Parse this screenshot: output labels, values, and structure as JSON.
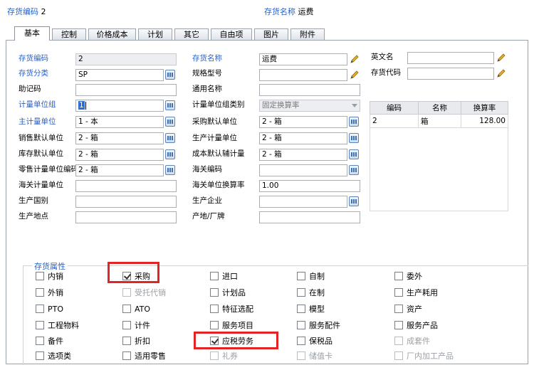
{
  "header": {
    "code_label": "存货编码",
    "code_value": "2",
    "name_label": "存货名称",
    "name_value": "运费"
  },
  "tabs": [
    "基本",
    "控制",
    "价格成本",
    "计划",
    "其它",
    "自由项",
    "图片",
    "附件"
  ],
  "fields": {
    "code": {
      "label": "存货编码",
      "value": "2"
    },
    "category": {
      "label": "存货分类",
      "value": "SP"
    },
    "mnemonic": {
      "label": "助记码",
      "value": ""
    },
    "unit_group": {
      "label": "计量单位组",
      "value": "1"
    },
    "main_unit": {
      "label": "主计量单位",
      "value": "1 - 本"
    },
    "sales_unit": {
      "label": "销售默认单位",
      "value": "2 - 箱"
    },
    "stock_unit": {
      "label": "库存默认单位",
      "value": "2 - 箱"
    },
    "retail_unit": {
      "label": "零售计量单位编码",
      "value": "2 - 箱"
    },
    "customs_unit": {
      "label": "海关计量单位",
      "value": ""
    },
    "origin_country": {
      "label": "生产国别",
      "value": ""
    },
    "origin_place": {
      "label": "生产地点",
      "value": ""
    },
    "name": {
      "label": "存货名称",
      "value": "运费"
    },
    "spec": {
      "label": "规格型号",
      "value": ""
    },
    "common_name": {
      "label": "通用名称",
      "value": ""
    },
    "unit_group_type": {
      "label": "计量单位组类别",
      "value": "固定换算率"
    },
    "purchase_unit": {
      "label": "采购默认单位",
      "value": "2 - 箱"
    },
    "production_unit": {
      "label": "生产计量单位",
      "value": "2 - 箱"
    },
    "cost_unit": {
      "label": "成本默认辅计量",
      "value": "2 - 箱"
    },
    "customs_code": {
      "label": "海关编码",
      "value": ""
    },
    "customs_rate": {
      "label": "海关单位换算率",
      "value": "1.00"
    },
    "manufacturer": {
      "label": "生产企业",
      "value": ""
    },
    "brand": {
      "label": "产地/厂牌",
      "value": ""
    },
    "english_name": {
      "label": "英文名",
      "value": ""
    },
    "inventory_code": {
      "label": "存货代码",
      "value": ""
    }
  },
  "unit_table": {
    "headers": [
      "编码",
      "名称",
      "换算率"
    ],
    "rows": [
      [
        "2",
        "箱",
        "128.00"
      ]
    ]
  },
  "attributes": {
    "title": "存货属性",
    "items": [
      {
        "label": "内销",
        "checked": false,
        "enabled": true
      },
      {
        "label": "采购",
        "checked": true,
        "enabled": true
      },
      {
        "label": "进口",
        "checked": false,
        "enabled": true
      },
      {
        "label": "自制",
        "checked": false,
        "enabled": true
      },
      {
        "label": "委外",
        "checked": false,
        "enabled": true
      },
      {
        "label": "外销",
        "checked": false,
        "enabled": true
      },
      {
        "label": "受托代销",
        "checked": false,
        "enabled": false
      },
      {
        "label": "计划品",
        "checked": false,
        "enabled": true
      },
      {
        "label": "在制",
        "checked": false,
        "enabled": true
      },
      {
        "label": "生产耗用",
        "checked": false,
        "enabled": true
      },
      {
        "label": "PTO",
        "checked": false,
        "enabled": true
      },
      {
        "label": "ATO",
        "checked": false,
        "enabled": true
      },
      {
        "label": "特征选配",
        "checked": false,
        "enabled": true
      },
      {
        "label": "模型",
        "checked": false,
        "enabled": true
      },
      {
        "label": "资产",
        "checked": false,
        "enabled": true
      },
      {
        "label": "工程物料",
        "checked": false,
        "enabled": true
      },
      {
        "label": "计件",
        "checked": false,
        "enabled": true
      },
      {
        "label": "服务项目",
        "checked": false,
        "enabled": true
      },
      {
        "label": "服务配件",
        "checked": false,
        "enabled": true
      },
      {
        "label": "服务产品",
        "checked": false,
        "enabled": true
      },
      {
        "label": "备件",
        "checked": false,
        "enabled": true
      },
      {
        "label": "折扣",
        "checked": false,
        "enabled": true
      },
      {
        "label": "应税劳务",
        "checked": true,
        "enabled": true
      },
      {
        "label": "保税品",
        "checked": false,
        "enabled": true
      },
      {
        "label": "成套件",
        "checked": false,
        "enabled": false
      },
      {
        "label": "选项类",
        "checked": false,
        "enabled": true
      },
      {
        "label": "适用零售",
        "checked": false,
        "enabled": true
      },
      {
        "label": "礼券",
        "checked": false,
        "enabled": false
      },
      {
        "label": "储值卡",
        "checked": false,
        "enabled": false
      },
      {
        "label": "厂内加工产品",
        "checked": false,
        "enabled": false
      }
    ]
  },
  "colors": {
    "accent": "#2a62c9",
    "highlight": "#e32424"
  }
}
